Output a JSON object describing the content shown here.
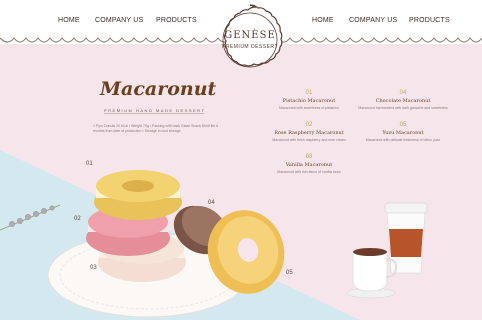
{
  "nav": {
    "left": [
      "HOME",
      "COMPANY US",
      "PRODUCTS"
    ],
    "right": [
      "HOME",
      "COMPANY US",
      "PRODUCTS"
    ]
  },
  "logo": {
    "name": "GENÈSE",
    "sub": "PREMIUM DESSERT"
  },
  "brand": {
    "title": "Macaronut",
    "subtitle": "PREMIUM HAND MADE DESSERT",
    "description": "1 Pyro Donuts 20 kCal • Weight 70g • Packing with back Glaze Snack Shelf life 6 months from date of production • Storage in cool storage"
  },
  "products": [
    {
      "num": "01",
      "name": "Pistachio Macaronut",
      "desc": "Macaronut with sweetness of pistachio"
    },
    {
      "num": "02",
      "name": "Rose Raspberry Macaronut",
      "desc": "Macaronut with fresh raspberry and rose cream"
    },
    {
      "num": "03",
      "name": "Vanilla Macaronut",
      "desc": "Macaronut with rich flavor of vanilla bean"
    },
    {
      "num": "04",
      "name": "Chocolate Macaronut",
      "desc": "Macaronut harmonized with dark ganache and sweetness"
    },
    {
      "num": "05",
      "name": "Yuzu Macaronut",
      "desc": "Macaronut with delicate freshness of citrus yuzu"
    }
  ],
  "markers": [
    "01",
    "02",
    "03",
    "04",
    "05"
  ],
  "colors": {
    "background_pink": "#f6e6ec",
    "blue_surface": "#cfe6ee",
    "brand_brown": "#6b3f1e",
    "accent_gold": "#c7a55f",
    "coffee_cup": "#b8542a"
  }
}
